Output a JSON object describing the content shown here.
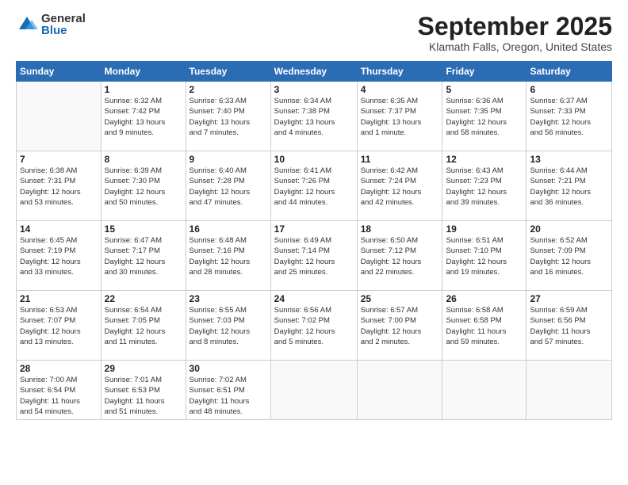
{
  "logo": {
    "general": "General",
    "blue": "Blue"
  },
  "title": "September 2025",
  "subtitle": "Klamath Falls, Oregon, United States",
  "headers": [
    "Sunday",
    "Monday",
    "Tuesday",
    "Wednesday",
    "Thursday",
    "Friday",
    "Saturday"
  ],
  "weeks": [
    [
      {
        "day": "",
        "info": ""
      },
      {
        "day": "1",
        "info": "Sunrise: 6:32 AM\nSunset: 7:42 PM\nDaylight: 13 hours\nand 9 minutes."
      },
      {
        "day": "2",
        "info": "Sunrise: 6:33 AM\nSunset: 7:40 PM\nDaylight: 13 hours\nand 7 minutes."
      },
      {
        "day": "3",
        "info": "Sunrise: 6:34 AM\nSunset: 7:38 PM\nDaylight: 13 hours\nand 4 minutes."
      },
      {
        "day": "4",
        "info": "Sunrise: 6:35 AM\nSunset: 7:37 PM\nDaylight: 13 hours\nand 1 minute."
      },
      {
        "day": "5",
        "info": "Sunrise: 6:36 AM\nSunset: 7:35 PM\nDaylight: 12 hours\nand 58 minutes."
      },
      {
        "day": "6",
        "info": "Sunrise: 6:37 AM\nSunset: 7:33 PM\nDaylight: 12 hours\nand 56 minutes."
      }
    ],
    [
      {
        "day": "7",
        "info": "Sunrise: 6:38 AM\nSunset: 7:31 PM\nDaylight: 12 hours\nand 53 minutes."
      },
      {
        "day": "8",
        "info": "Sunrise: 6:39 AM\nSunset: 7:30 PM\nDaylight: 12 hours\nand 50 minutes."
      },
      {
        "day": "9",
        "info": "Sunrise: 6:40 AM\nSunset: 7:28 PM\nDaylight: 12 hours\nand 47 minutes."
      },
      {
        "day": "10",
        "info": "Sunrise: 6:41 AM\nSunset: 7:26 PM\nDaylight: 12 hours\nand 44 minutes."
      },
      {
        "day": "11",
        "info": "Sunrise: 6:42 AM\nSunset: 7:24 PM\nDaylight: 12 hours\nand 42 minutes."
      },
      {
        "day": "12",
        "info": "Sunrise: 6:43 AM\nSunset: 7:23 PM\nDaylight: 12 hours\nand 39 minutes."
      },
      {
        "day": "13",
        "info": "Sunrise: 6:44 AM\nSunset: 7:21 PM\nDaylight: 12 hours\nand 36 minutes."
      }
    ],
    [
      {
        "day": "14",
        "info": "Sunrise: 6:45 AM\nSunset: 7:19 PM\nDaylight: 12 hours\nand 33 minutes."
      },
      {
        "day": "15",
        "info": "Sunrise: 6:47 AM\nSunset: 7:17 PM\nDaylight: 12 hours\nand 30 minutes."
      },
      {
        "day": "16",
        "info": "Sunrise: 6:48 AM\nSunset: 7:16 PM\nDaylight: 12 hours\nand 28 minutes."
      },
      {
        "day": "17",
        "info": "Sunrise: 6:49 AM\nSunset: 7:14 PM\nDaylight: 12 hours\nand 25 minutes."
      },
      {
        "day": "18",
        "info": "Sunrise: 6:50 AM\nSunset: 7:12 PM\nDaylight: 12 hours\nand 22 minutes."
      },
      {
        "day": "19",
        "info": "Sunrise: 6:51 AM\nSunset: 7:10 PM\nDaylight: 12 hours\nand 19 minutes."
      },
      {
        "day": "20",
        "info": "Sunrise: 6:52 AM\nSunset: 7:09 PM\nDaylight: 12 hours\nand 16 minutes."
      }
    ],
    [
      {
        "day": "21",
        "info": "Sunrise: 6:53 AM\nSunset: 7:07 PM\nDaylight: 12 hours\nand 13 minutes."
      },
      {
        "day": "22",
        "info": "Sunrise: 6:54 AM\nSunset: 7:05 PM\nDaylight: 12 hours\nand 11 minutes."
      },
      {
        "day": "23",
        "info": "Sunrise: 6:55 AM\nSunset: 7:03 PM\nDaylight: 12 hours\nand 8 minutes."
      },
      {
        "day": "24",
        "info": "Sunrise: 6:56 AM\nSunset: 7:02 PM\nDaylight: 12 hours\nand 5 minutes."
      },
      {
        "day": "25",
        "info": "Sunrise: 6:57 AM\nSunset: 7:00 PM\nDaylight: 12 hours\nand 2 minutes."
      },
      {
        "day": "26",
        "info": "Sunrise: 6:58 AM\nSunset: 6:58 PM\nDaylight: 11 hours\nand 59 minutes."
      },
      {
        "day": "27",
        "info": "Sunrise: 6:59 AM\nSunset: 6:56 PM\nDaylight: 11 hours\nand 57 minutes."
      }
    ],
    [
      {
        "day": "28",
        "info": "Sunrise: 7:00 AM\nSunset: 6:54 PM\nDaylight: 11 hours\nand 54 minutes."
      },
      {
        "day": "29",
        "info": "Sunrise: 7:01 AM\nSunset: 6:53 PM\nDaylight: 11 hours\nand 51 minutes."
      },
      {
        "day": "30",
        "info": "Sunrise: 7:02 AM\nSunset: 6:51 PM\nDaylight: 11 hours\nand 48 minutes."
      },
      {
        "day": "",
        "info": ""
      },
      {
        "day": "",
        "info": ""
      },
      {
        "day": "",
        "info": ""
      },
      {
        "day": "",
        "info": ""
      }
    ]
  ]
}
